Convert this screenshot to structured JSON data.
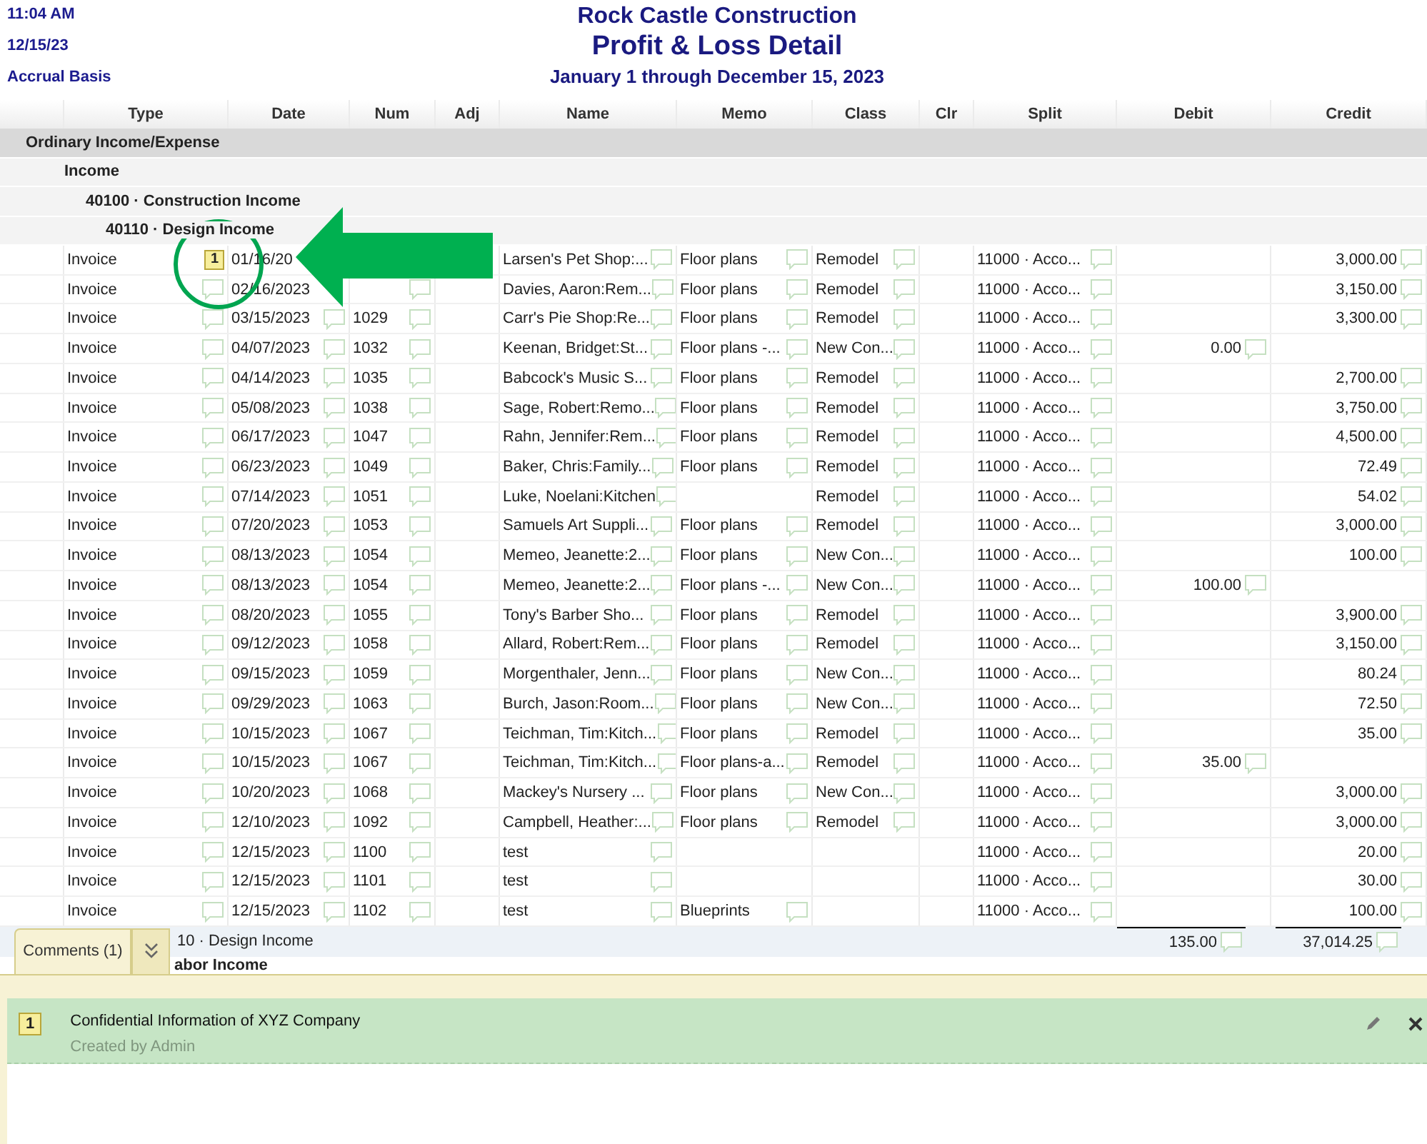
{
  "report": {
    "time": "11:04 AM",
    "date": "12/15/23",
    "basis": "Accrual Basis",
    "company": "Rock Castle Construction",
    "title": "Profit & Loss Detail",
    "period": "January 1 through December 15, 2023"
  },
  "columns": [
    "Type",
    "Date",
    "Num",
    "Adj",
    "Name",
    "Memo",
    "Class",
    "Clr",
    "Split",
    "Debit",
    "Credit"
  ],
  "sections": [
    {
      "label": "Ordinary Income/Expense",
      "children": [
        {
          "label": "Income",
          "children": [
            {
              "label": "40100 · Construction Income",
              "children": [
                {
                  "label": "40110 · Design Income"
                }
              ]
            }
          ]
        }
      ]
    }
  ],
  "rows": [
    {
      "type": "Invoice",
      "comment_count": "1",
      "date": "01/16/20",
      "name": "Larsen's Pet Shop:...",
      "memo": "Floor plans",
      "class": "Remodel",
      "split": "11000 · Acco...",
      "credit": "3,000.00"
    },
    {
      "type": "Invoice",
      "date": "02/16/2023",
      "name": "Davies, Aaron:Rem...",
      "memo": "Floor plans",
      "class": "Remodel",
      "split": "11000 · Acco...",
      "credit": "3,150.00"
    },
    {
      "type": "Invoice",
      "date": "03/15/2023",
      "num": "1029",
      "name": "Carr's Pie Shop:Re...",
      "memo": "Floor plans",
      "class": "Remodel",
      "split": "11000 · Acco...",
      "credit": "3,300.00"
    },
    {
      "type": "Invoice",
      "date": "04/07/2023",
      "num": "1032",
      "name": "Keenan, Bridget:St...",
      "memo": "Floor plans -...",
      "class": "New Con...",
      "split": "11000 · Acco...",
      "debit": "0.00"
    },
    {
      "type": "Invoice",
      "date": "04/14/2023",
      "num": "1035",
      "name": "Babcock's Music S...",
      "memo": "Floor plans",
      "class": "Remodel",
      "split": "11000 · Acco...",
      "credit": "2,700.00"
    },
    {
      "type": "Invoice",
      "date": "05/08/2023",
      "num": "1038",
      "name": "Sage, Robert:Remo...",
      "memo": "Floor plans",
      "class": "Remodel",
      "split": "11000 · Acco...",
      "credit": "3,750.00"
    },
    {
      "type": "Invoice",
      "date": "06/17/2023",
      "num": "1047",
      "name": "Rahn, Jennifer:Rem...",
      "memo": "Floor plans",
      "class": "Remodel",
      "split": "11000 · Acco...",
      "credit": "4,500.00"
    },
    {
      "type": "Invoice",
      "date": "06/23/2023",
      "num": "1049",
      "name": "Baker, Chris:Family...",
      "memo": "Floor plans",
      "class": "Remodel",
      "split": "11000 · Acco...",
      "credit": "72.49"
    },
    {
      "type": "Invoice",
      "date": "07/14/2023",
      "num": "1051",
      "name": "Luke, Noelani:Kitchen",
      "class": "Remodel",
      "split": "11000 · Acco...",
      "credit": "54.02"
    },
    {
      "type": "Invoice",
      "date": "07/20/2023",
      "num": "1053",
      "name": "Samuels Art Suppli...",
      "memo": "Floor plans",
      "class": "Remodel",
      "split": "11000 · Acco...",
      "credit": "3,000.00"
    },
    {
      "type": "Invoice",
      "date": "08/13/2023",
      "num": "1054",
      "name": "Memeo, Jeanette:2...",
      "memo": "Floor plans",
      "class": "New Con...",
      "split": "11000 · Acco...",
      "credit": "100.00"
    },
    {
      "type": "Invoice",
      "date": "08/13/2023",
      "num": "1054",
      "name": "Memeo, Jeanette:2...",
      "memo": "Floor plans -...",
      "class": "New Con...",
      "split": "11000 · Acco...",
      "debit": "100.00"
    },
    {
      "type": "Invoice",
      "date": "08/20/2023",
      "num": "1055",
      "name": "Tony's Barber Sho...",
      "memo": "Floor plans",
      "class": "Remodel",
      "split": "11000 · Acco...",
      "credit": "3,900.00"
    },
    {
      "type": "Invoice",
      "date": "09/12/2023",
      "num": "1058",
      "name": "Allard, Robert:Rem...",
      "memo": "Floor plans",
      "class": "Remodel",
      "split": "11000 · Acco...",
      "credit": "3,150.00"
    },
    {
      "type": "Invoice",
      "date": "09/15/2023",
      "num": "1059",
      "name": "Morgenthaler, Jenn...",
      "memo": "Floor plans",
      "class": "New Con...",
      "split": "11000 · Acco...",
      "credit": "80.24"
    },
    {
      "type": "Invoice",
      "date": "09/29/2023",
      "num": "1063",
      "name": "Burch, Jason:Room...",
      "memo": "Floor plans",
      "class": "New Con...",
      "split": "11000 · Acco...",
      "credit": "72.50"
    },
    {
      "type": "Invoice",
      "date": "10/15/2023",
      "num": "1067",
      "name": "Teichman, Tim:Kitch...",
      "memo": "Floor plans",
      "class": "Remodel",
      "split": "11000 · Acco...",
      "credit": "35.00"
    },
    {
      "type": "Invoice",
      "date": "10/15/2023",
      "num": "1067",
      "name": "Teichman, Tim:Kitch...",
      "memo": "Floor plans-a...",
      "class": "Remodel",
      "split": "11000 · Acco...",
      "debit": "35.00"
    },
    {
      "type": "Invoice",
      "date": "10/20/2023",
      "num": "1068",
      "name": "Mackey's Nursery ...",
      "memo": "Floor plans",
      "class": "New Con...",
      "split": "11000 · Acco...",
      "credit": "3,000.00"
    },
    {
      "type": "Invoice",
      "date": "12/10/2023",
      "num": "1092",
      "name": "Campbell, Heather:...",
      "memo": "Floor plans",
      "class": "Remodel",
      "split": "11000 · Acco...",
      "credit": "3,000.00"
    },
    {
      "type": "Invoice",
      "date": "12/15/2023",
      "num": "1100",
      "name": "test",
      "split": "11000 · Acco...",
      "credit": "20.00"
    },
    {
      "type": "Invoice",
      "date": "12/15/2023",
      "num": "1101",
      "name": "test",
      "split": "11000 · Acco...",
      "credit": "30.00"
    },
    {
      "type": "Invoice",
      "date": "12/15/2023",
      "num": "1102",
      "name": "test",
      "memo": "Blueprints",
      "split": "11000 · Acco...",
      "credit": "100.00"
    }
  ],
  "total": {
    "label": "10 · Design Income",
    "debit": "135.00",
    "credit": "37,014.25"
  },
  "next_section": "abor Income",
  "comments": {
    "tab_label": "Comments  (1)",
    "items": [
      {
        "count": "1",
        "text": "Confidential Information of XYZ Company",
        "author": "Created by Admin"
      }
    ]
  }
}
